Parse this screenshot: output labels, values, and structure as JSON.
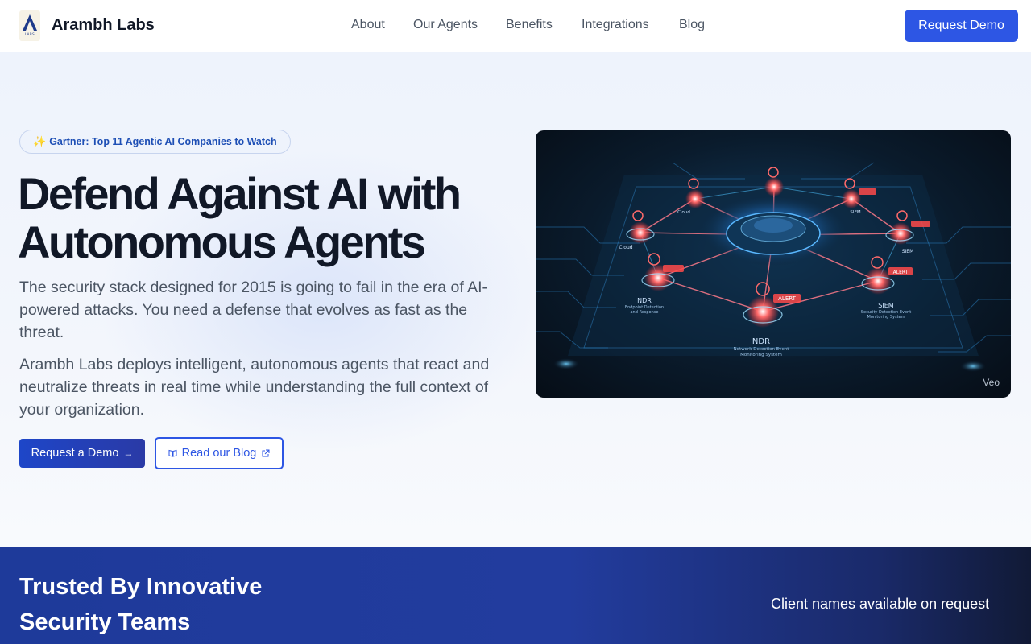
{
  "header": {
    "brand": "Arambh Labs",
    "logo_sub": "LABS",
    "nav": [
      {
        "label": "About"
      },
      {
        "label": "Our Agents"
      },
      {
        "label": "Benefits"
      },
      {
        "label": "Integrations"
      },
      {
        "label": "Blog"
      }
    ],
    "cta_label": "Request Demo"
  },
  "hero": {
    "badge": {
      "icon": "sparkles-icon",
      "text": "Gartner: Top 11 Agentic AI Companies to Watch"
    },
    "headline_line1": "Defend Against AI with",
    "headline_line2": "Autonomous Agents",
    "paragraph1": "The security stack designed for 2015 is going to fail in the era of AI-powered attacks. You need a defense that evolves as fast as the threat.",
    "paragraph2": "Arambh Labs deploys intelligent, autonomous agents that react and neutralize threats in real time while understanding the full context of your organization.",
    "primary_cta": "Request a Demo",
    "secondary_cta": "Read our Blog",
    "image": {
      "watermark": "Veo",
      "node_labels": [
        "NDR",
        "SIEM",
        "Cloud",
        "ALERT"
      ],
      "node_captions": [
        "Network Detection Event Monitoring System",
        "Endpoint Detection and Response",
        "Security Detection Event Monitoring System"
      ]
    }
  },
  "trusted": {
    "title": "Trusted By Innovative Security Teams",
    "note": "Client names available on request"
  },
  "colors": {
    "accent": "#2d56e4",
    "headline": "#111827",
    "body_text": "#4b5563",
    "band": "#1e3a9a",
    "alert": "#ff5a5a"
  }
}
